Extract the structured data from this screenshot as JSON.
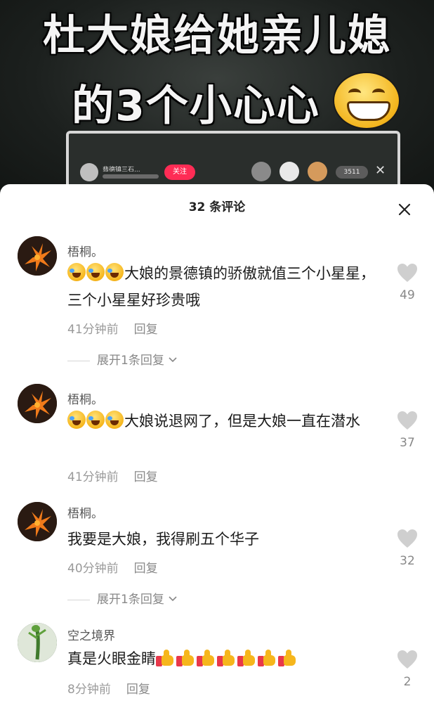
{
  "video": {
    "caption_line1": "杜大娘给她亲儿媳",
    "caption_line2": "的3个小心心",
    "live_name": "翡德镇三石...",
    "follow_label": "关注",
    "viewer_count": "3511",
    "close_symbol": "✕"
  },
  "panel": {
    "title": "32 条评论",
    "close_icon": "close-icon"
  },
  "comments": [
    {
      "user": "梧桐。",
      "emoji_prefix": [
        "laughing-crying-emoji",
        "laughing-crying-emoji",
        "laughing-crying-emoji"
      ],
      "text": "大娘的景德镇的骄傲就值三个小星星，三个小星星好珍贵哦",
      "time": "41分钟前",
      "reply": "回复",
      "likes": "49",
      "expand": "展开1条回复"
    },
    {
      "user": "梧桐。",
      "emoji_prefix": [
        "laughing-crying-emoji",
        "laughing-crying-emoji",
        "laughing-crying-emoji"
      ],
      "text": "大娘说退网了，但是大娘一直在潜水",
      "time": "41分钟前",
      "reply": "回复",
      "likes": "37"
    },
    {
      "user": "梧桐。",
      "text": "我要是大娘，我得刷五个华子",
      "time": "40分钟前",
      "reply": "回复",
      "likes": "32",
      "expand": "展开1条回复"
    },
    {
      "user": "空之境界",
      "text": "真是火眼金睛",
      "emoji_suffix_count": 7,
      "emoji_suffix": "thumbs-up-emoji",
      "time": "8分钟前",
      "reply": "回复",
      "likes": "2"
    }
  ],
  "colors": {
    "follow_button": "#fe2c55",
    "like_heart": "#cfcfcf",
    "meta_text": "#9a9a9a"
  }
}
